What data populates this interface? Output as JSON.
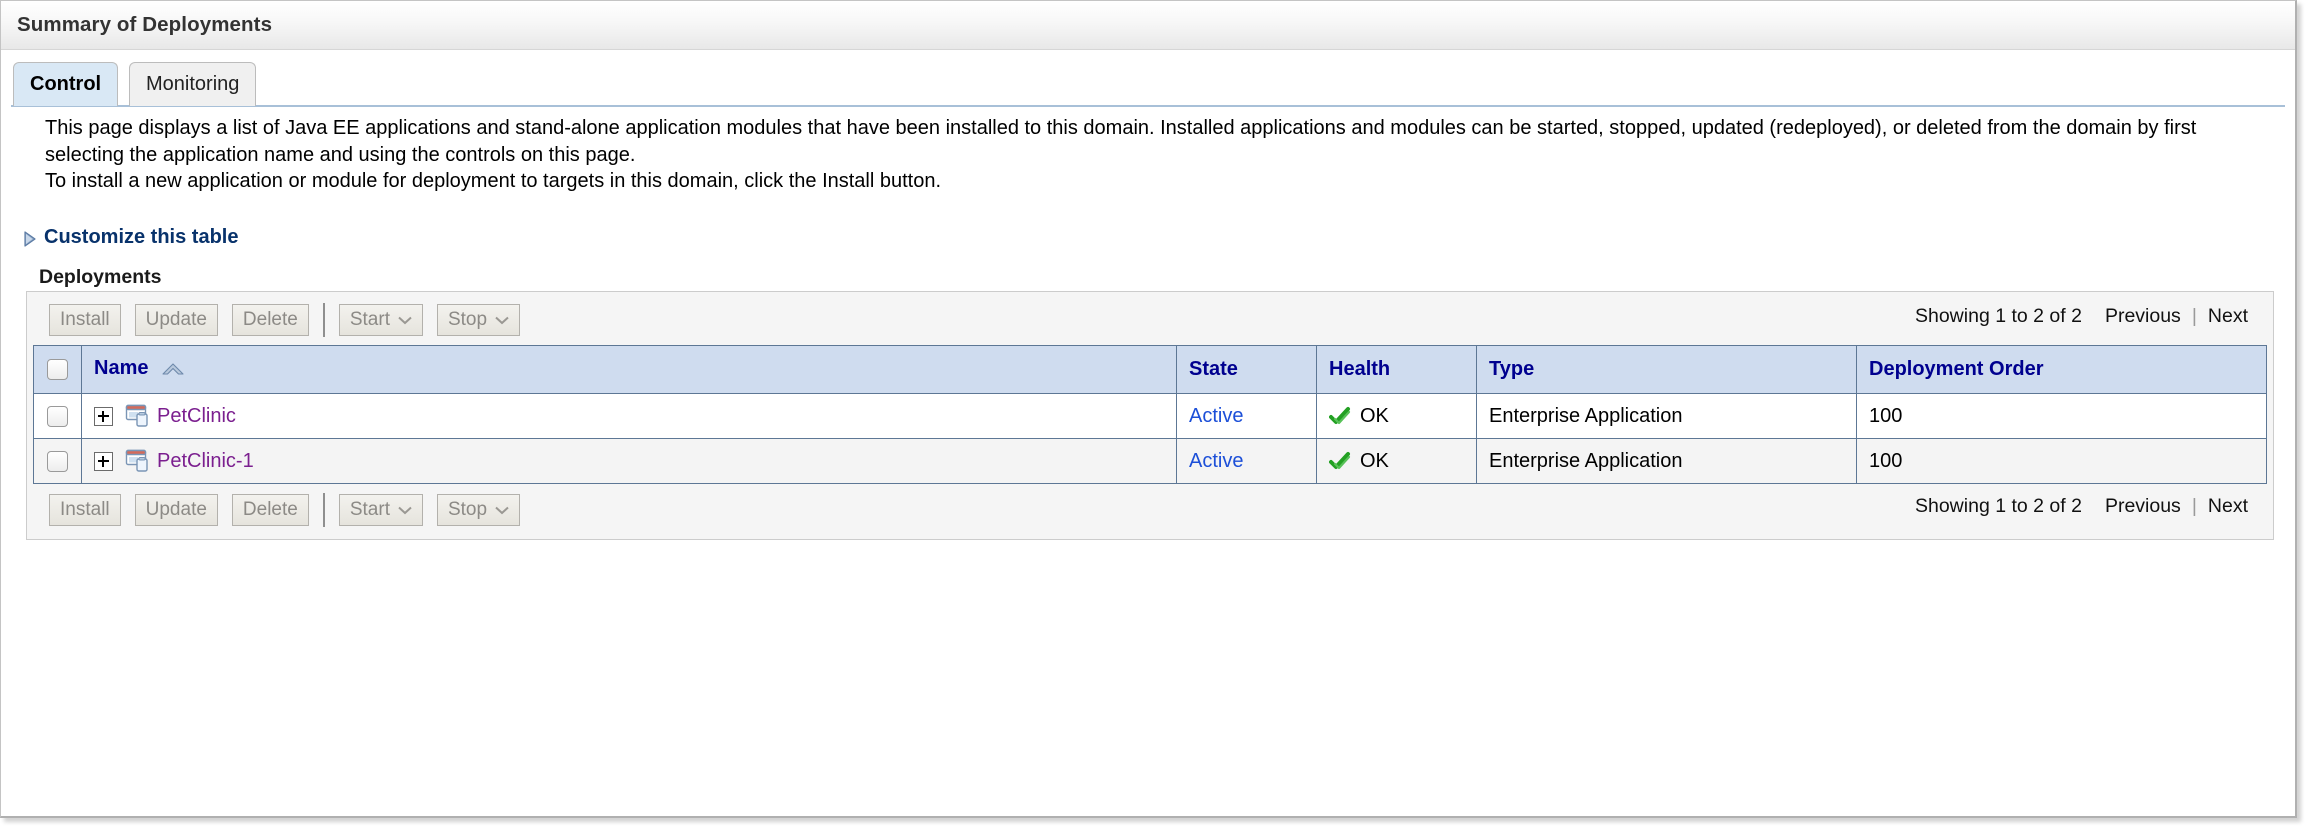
{
  "header": {
    "title": "Summary of Deployments"
  },
  "tabs": [
    {
      "label": "Control",
      "active": true
    },
    {
      "label": "Monitoring",
      "active": false
    }
  ],
  "description": {
    "paragraph1": "This page displays a list of Java EE applications and stand-alone application modules that have been installed to this domain. Installed applications and modules can be started, stopped, updated (redeployed), or deleted from the domain by first selecting the application name and using the controls on this page.",
    "paragraph2": "To install a new application or module for deployment to targets in this domain, click the Install button."
  },
  "customize": {
    "label": "Customize this table",
    "icon": "triangle-right-icon"
  },
  "section": {
    "heading": "Deployments"
  },
  "toolbar": {
    "install_label": "Install",
    "update_label": "Update",
    "delete_label": "Delete",
    "start_label": "Start",
    "stop_label": "Stop",
    "caret": "⌄"
  },
  "pager": {
    "showing": "Showing 1 to 2 of 2",
    "previous": "Previous",
    "next": "Next",
    "divider": "|"
  },
  "table": {
    "columns": [
      {
        "label": "Name",
        "sorted": "asc"
      },
      {
        "label": "State"
      },
      {
        "label": "Health"
      },
      {
        "label": "Type"
      },
      {
        "label": "Deployment Order"
      }
    ],
    "rows": [
      {
        "name": "PetClinic",
        "state": "Active",
        "health": "OK",
        "type": "Enterprise Application",
        "order": "100"
      },
      {
        "name": "PetClinic-1",
        "state": "Active",
        "health": "OK",
        "type": "Enterprise Application",
        "order": "100"
      }
    ]
  },
  "colors": {
    "header_bg": "#cfdcef",
    "header_text": "#00008f",
    "link_visited": "#7b1f8f",
    "link_state": "#1c4fd8",
    "health_ok": "#21a121",
    "tab_active_bg": "#d9e8f5",
    "customize_link": "#08326b"
  }
}
